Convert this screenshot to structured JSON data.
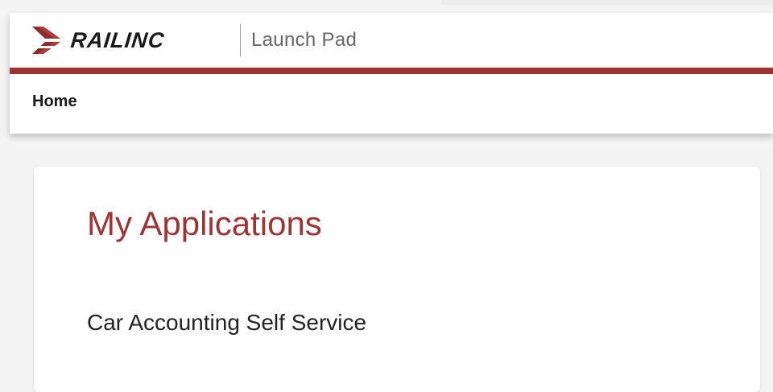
{
  "header": {
    "brand": "RAILINC",
    "app_name": "Launch Pad",
    "accent_color": "#9e3434",
    "logo_icon": "railinc-logo-icon"
  },
  "nav": {
    "home_label": "Home"
  },
  "main": {
    "section_title": "My Applications",
    "applications": [
      {
        "label": "Car Accounting Self Service"
      }
    ]
  }
}
